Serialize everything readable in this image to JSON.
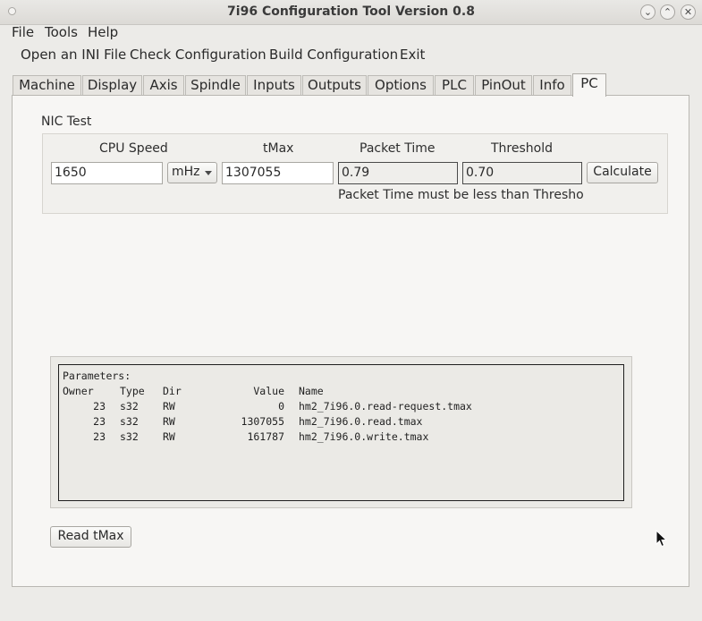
{
  "window": {
    "title": "7i96 Configuration Tool Version 0.8"
  },
  "menubar": {
    "items": [
      "File",
      "Tools",
      "Help"
    ]
  },
  "toolbar": {
    "items": [
      "Open an INI File",
      "Check Configuration",
      "Build Configuration",
      "Exit"
    ]
  },
  "tabs": {
    "items": [
      "Machine",
      "Display",
      "Axis",
      "Spindle",
      "Inputs",
      "Outputs",
      "Options",
      "PLC",
      "PinOut",
      "Info",
      "PC"
    ],
    "active": "PC"
  },
  "nic_test": {
    "label": "NIC Test",
    "headers": {
      "cpu_speed": "CPU Speed",
      "tmax": "tMax",
      "packet_time": "Packet Time",
      "threshold": "Threshold"
    },
    "cpu_speed": "1650",
    "unit": "mHz",
    "tmax": "1307055",
    "packet_time": "0.79",
    "threshold": "0.70",
    "calculate_label": "Calculate",
    "note": "Packet Time must be less than Threshold"
  },
  "parameters": {
    "title": "Parameters:",
    "columns": {
      "owner": "Owner",
      "type": "Type",
      "dir": "Dir",
      "value": "Value",
      "name": "Name"
    },
    "rows": [
      {
        "owner": "23",
        "type": "s32",
        "dir": "RW",
        "value": "0",
        "name": "hm2_7i96.0.read-request.tmax"
      },
      {
        "owner": "23",
        "type": "s32",
        "dir": "RW",
        "value": "1307055",
        "name": "hm2_7i96.0.read.tmax"
      },
      {
        "owner": "23",
        "type": "s32",
        "dir": "RW",
        "value": "161787",
        "name": "hm2_7i96.0.write.tmax"
      }
    ]
  },
  "read_tmax_label": "Read tMax",
  "icons": {
    "window_minimize": "chevron-down-icon",
    "window_maximize": "chevron-up-icon",
    "window_close": "close-icon",
    "cursor": "mouse-pointer-icon"
  }
}
